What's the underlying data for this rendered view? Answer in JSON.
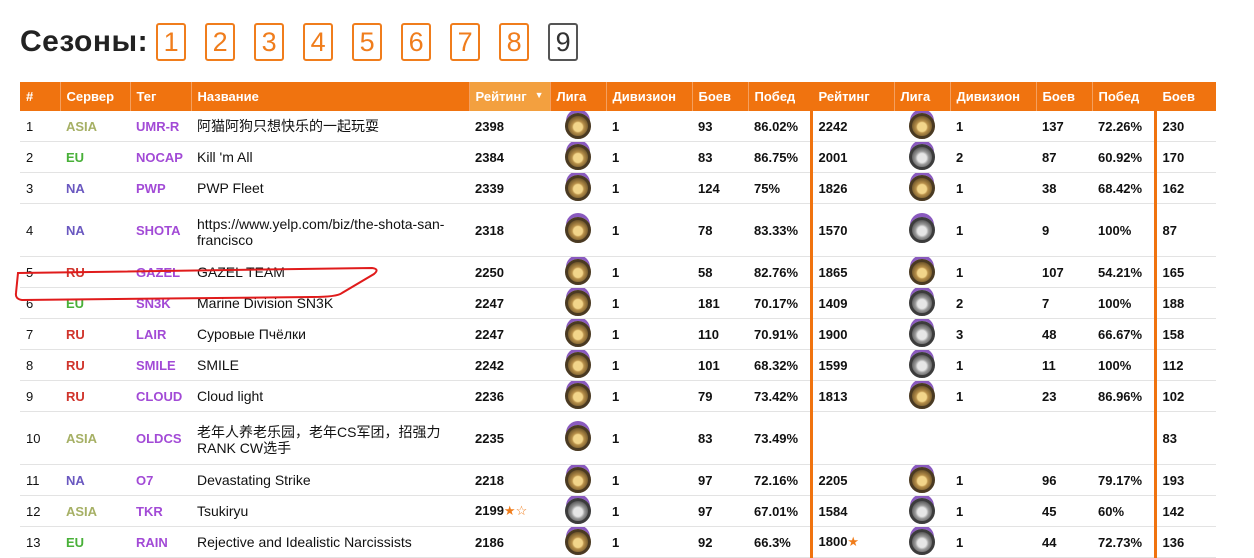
{
  "seasons": {
    "title": "Сезоны:",
    "items": [
      "1",
      "2",
      "3",
      "4",
      "5",
      "6",
      "7",
      "8",
      "9"
    ],
    "active": "9"
  },
  "table": {
    "headers": [
      "#",
      "Сервер",
      "Тег",
      "Название",
      "Рейтинг",
      "Лига",
      "Дивизион",
      "Боев",
      "Побед",
      "Рейтинг",
      "Лига",
      "Дивизион",
      "Боев",
      "Побед",
      "Боев"
    ],
    "rows": [
      {
        "rank": "1",
        "server": "ASIA",
        "tag": "UMR-R",
        "name": "阿猫阿狗只想快乐的一起玩耍",
        "rating": "2398",
        "star": "",
        "league": "gold",
        "division": "1",
        "battles": "93",
        "wins": "86.02%",
        "prev_rating": "2242",
        "prev_league": "gold",
        "prev_division": "1",
        "prev_battles": "137",
        "prev_wins": "72.26%",
        "total_battles": "230"
      },
      {
        "rank": "2",
        "server": "EU",
        "tag": "NOCAP",
        "name": "Kill 'm All",
        "rating": "2384",
        "star": "",
        "league": "gold",
        "division": "1",
        "battles": "83",
        "wins": "86.75%",
        "prev_rating": "2001",
        "prev_league": "silver",
        "prev_division": "2",
        "prev_battles": "87",
        "prev_wins": "60.92%",
        "total_battles": "170"
      },
      {
        "rank": "3",
        "server": "NA",
        "tag": "PWP",
        "name": "PWP Fleet",
        "rating": "2339",
        "star": "",
        "league": "gold",
        "division": "1",
        "battles": "124",
        "wins": "75%",
        "prev_rating": "1826",
        "prev_league": "gold",
        "prev_division": "1",
        "prev_battles": "38",
        "prev_wins": "68.42%",
        "total_battles": "162"
      },
      {
        "rank": "4",
        "server": "NA",
        "tag": "SHOTA",
        "name": "https://www.yelp.com/biz/the-shota-san-francisco",
        "rating": "2318",
        "star": "",
        "league": "gold",
        "division": "1",
        "battles": "78",
        "wins": "83.33%",
        "prev_rating": "1570",
        "prev_league": "silver",
        "prev_division": "1",
        "prev_battles": "9",
        "prev_wins": "100%",
        "total_battles": "87"
      },
      {
        "rank": "5",
        "server": "RU",
        "tag": "GAZEL",
        "name": "GAZEL TEAM",
        "rating": "2250",
        "star": "",
        "league": "gold",
        "division": "1",
        "battles": "58",
        "wins": "82.76%",
        "prev_rating": "1865",
        "prev_league": "gold",
        "prev_division": "1",
        "prev_battles": "107",
        "prev_wins": "54.21%",
        "total_battles": "165"
      },
      {
        "rank": "6",
        "server": "EU",
        "tag": "SN3K",
        "name": "Marine Division SN3K",
        "rating": "2247",
        "star": "",
        "league": "gold",
        "division": "1",
        "battles": "181",
        "wins": "70.17%",
        "prev_rating": "1409",
        "prev_league": "silver",
        "prev_division": "2",
        "prev_battles": "7",
        "prev_wins": "100%",
        "total_battles": "188"
      },
      {
        "rank": "7",
        "server": "RU",
        "tag": "LAIR",
        "name": "Суровые Пчёлки",
        "rating": "2247",
        "star": "",
        "league": "gold",
        "division": "1",
        "battles": "110",
        "wins": "70.91%",
        "prev_rating": "1900",
        "prev_league": "silver",
        "prev_division": "3",
        "prev_battles": "48",
        "prev_wins": "66.67%",
        "total_battles": "158"
      },
      {
        "rank": "8",
        "server": "RU",
        "tag": "SMILE",
        "name": "SMILE",
        "rating": "2242",
        "star": "",
        "league": "gold",
        "division": "1",
        "battles": "101",
        "wins": "68.32%",
        "prev_rating": "1599",
        "prev_league": "silver",
        "prev_division": "1",
        "prev_battles": "11",
        "prev_wins": "100%",
        "total_battles": "112"
      },
      {
        "rank": "9",
        "server": "RU",
        "tag": "CLOUD",
        "name": "Cloud light",
        "rating": "2236",
        "star": "",
        "league": "gold",
        "division": "1",
        "battles": "79",
        "wins": "73.42%",
        "prev_rating": "1813",
        "prev_league": "gold",
        "prev_division": "1",
        "prev_battles": "23",
        "prev_wins": "86.96%",
        "total_battles": "102"
      },
      {
        "rank": "10",
        "server": "ASIA",
        "tag": "OLDCS",
        "name": "老年人养老乐园，老年CS军团，招强力RANK CW选手",
        "rating": "2235",
        "star": "",
        "league": "gold",
        "division": "1",
        "battles": "83",
        "wins": "73.49%",
        "prev_rating": "",
        "prev_league": "",
        "prev_division": "",
        "prev_battles": "",
        "prev_wins": "",
        "total_battles": "83"
      },
      {
        "rank": "11",
        "server": "NA",
        "tag": "O7",
        "name": "Devastating Strike",
        "rating": "2218",
        "star": "",
        "league": "gold",
        "division": "1",
        "battles": "97",
        "wins": "72.16%",
        "prev_rating": "2205",
        "prev_league": "gold",
        "prev_division": "1",
        "prev_battles": "96",
        "prev_wins": "79.17%",
        "total_battles": "193"
      },
      {
        "rank": "12",
        "server": "ASIA",
        "tag": "TKR",
        "name": "Tsukiryu",
        "rating": "2199",
        "star": "★☆",
        "league": "silver",
        "division": "1",
        "battles": "97",
        "wins": "67.01%",
        "prev_rating": "1584",
        "prev_league": "silver",
        "prev_division": "1",
        "prev_battles": "45",
        "prev_wins": "60%",
        "total_battles": "142"
      },
      {
        "rank": "13",
        "server": "EU",
        "tag": "RAIN",
        "name": "Rejective and Idealistic Narcissists",
        "rating": "2186",
        "star": "",
        "league": "gold",
        "division": "1",
        "battles": "92",
        "wins": "66.3%",
        "prev_rating": "1800",
        "prev_star": "★",
        "prev_league": "silver",
        "prev_division": "1",
        "prev_battles": "44",
        "prev_wins": "72.73%",
        "total_battles": "136"
      }
    ]
  }
}
